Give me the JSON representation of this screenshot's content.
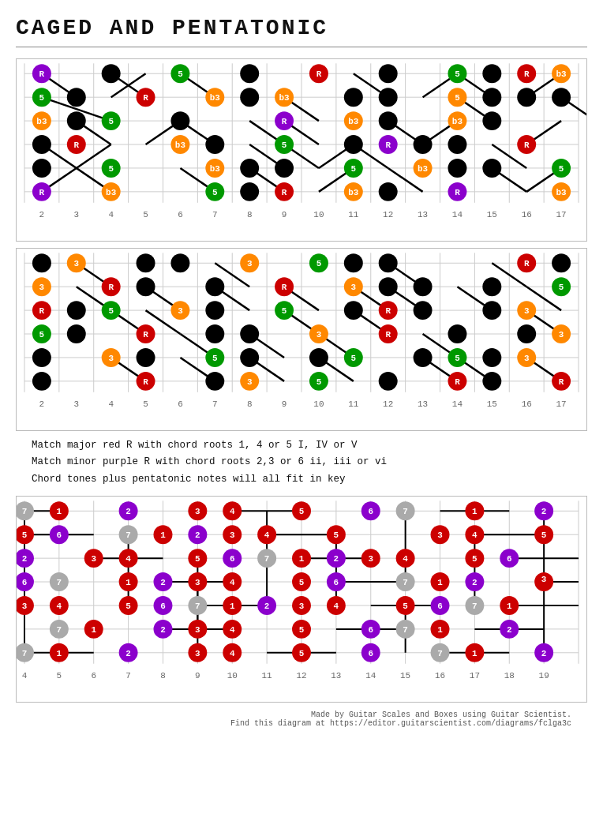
{
  "title": "CAGED  AND  PENTATONIC",
  "legend": [
    "Match major red R     with chord roots 1, 4 or 5   I, IV or V",
    "Match minor purple R   with chord roots  2,3 or 6   ii, iii or vi",
    "Chord tones plus pentatonic notes       will all fit in key"
  ],
  "footer1": "Made by Guitar Scales and Boxes using Guitar Scientist.",
  "footer2": "Find this diagram at https://editor.guitarscientist.com/diagrams/fclga3c"
}
